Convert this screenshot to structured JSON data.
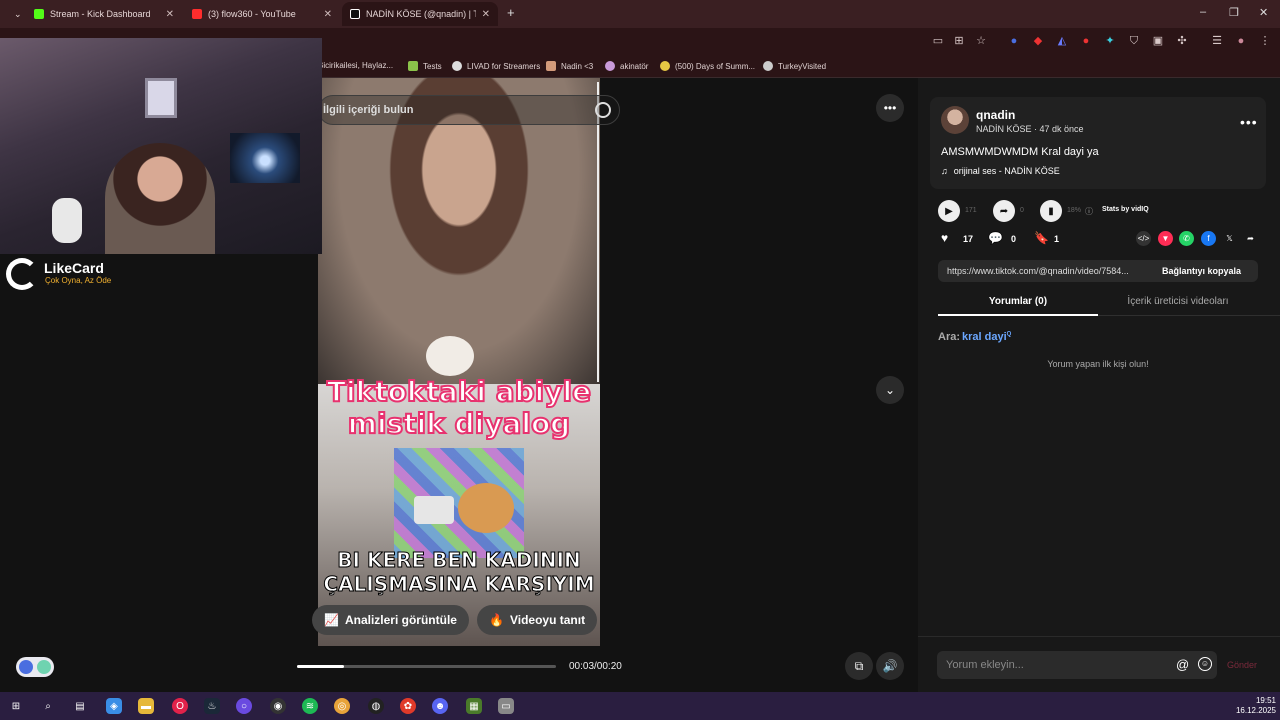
{
  "browser": {
    "tabs": [
      {
        "title": "Stream - Kick Dashboard",
        "color": "#53fc18"
      },
      {
        "title": "(3) flow360 - YouTube",
        "color": "#ff2d2d"
      },
      {
        "title": "NADİN KÖSE (@qnadin) | T",
        "color": "#ffffff"
      }
    ],
    "new_tab": "+",
    "window_controls": [
      "–",
      "❐",
      "✕"
    ],
    "bookmarks": [
      {
        "label": "Bicirikailesi, Haylaz...",
        "color": "#aa4444"
      },
      {
        "label": "Tests",
        "color": "#f2c230"
      },
      {
        "label": "LIVAD for Streamers",
        "color": "#cccccc"
      },
      {
        "label": "Nadin <3",
        "color": "#d29a7a"
      },
      {
        "label": "akinatör",
        "color": "#c99ad9"
      },
      {
        "label": "(500) Days of Summ...",
        "color": "#e6c844"
      },
      {
        "label": "TurkeyVisited",
        "color": "#cccccc"
      }
    ]
  },
  "overlay": {
    "brand": "LikeCard",
    "tagline": "Çok Oyna, Az Öde"
  },
  "video": {
    "search_placeholder": "İlgili içeriği bulun",
    "caption_top": "Tiktoktaki abiyle mistik diyalog",
    "caption_bottom": "BI KERE BEN KADININ ÇALIŞMASINA KARŞIYIM",
    "analytics_button": "Analizleri görüntüle",
    "promote_button": "Videoyu tanıt",
    "timecode": "00:03/00:20",
    "progress": 0.18,
    "more_label": "•••"
  },
  "panel": {
    "username": "qnadin",
    "meta": "NADİN KÖSE · 47 dk önce",
    "caption": "AMSMWMDWMDM Kral dayi ya",
    "music": "orijinal ses - NADİN KÖSE",
    "stats": {
      "plays": "171",
      "shares_stat": "0",
      "rate": "18%",
      "stats_by": "Stats by vidIQ"
    },
    "actions": {
      "likes": "17",
      "comments": "0",
      "saves": "1"
    },
    "share_colors": [
      "#ff2d55",
      "#25d366",
      "#1877f2"
    ],
    "url": "https://www.tiktok.com/@qnadin/video/7584...",
    "copy_link": "Bağlantıyı kopyala",
    "tabs": {
      "comments": "Yorumlar (0)",
      "creator": "İçerik üreticisi videoları"
    },
    "search_label": "Ara:",
    "search_term": "kral dayi",
    "empty_msg": "Yorum yapan ilk kişi olun!",
    "comment_placeholder": "Yorum ekleyin...",
    "send": "Gönder"
  },
  "taskbar": {
    "time": "19:51",
    "date": "16.12.2025"
  }
}
